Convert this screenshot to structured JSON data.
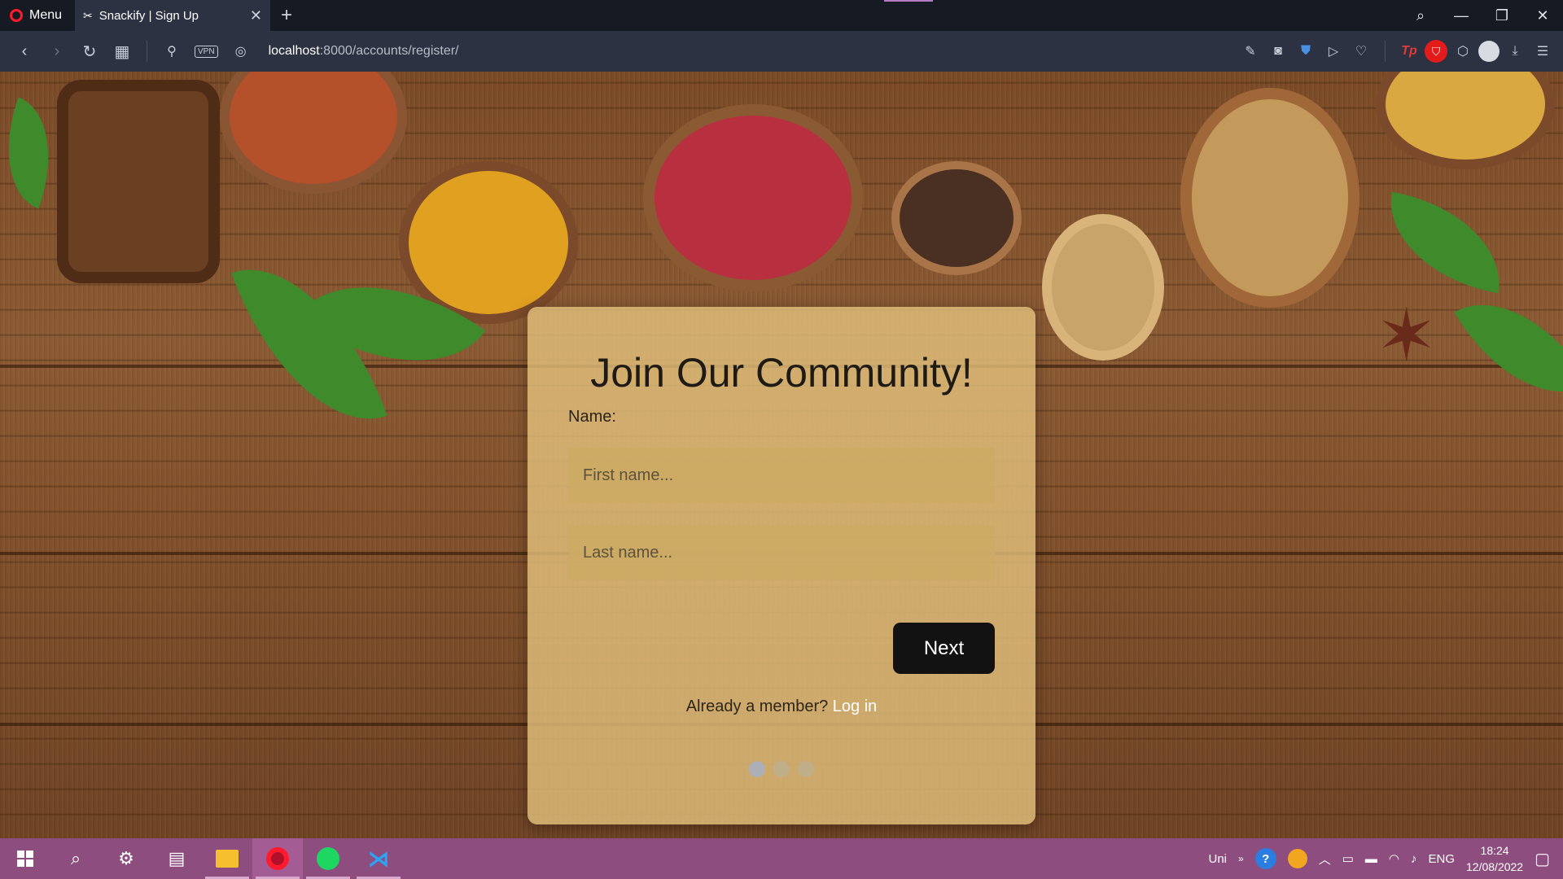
{
  "browser": {
    "menu_label": "Menu",
    "tab_title": "Snackify | Sign Up",
    "tab_close": "✕",
    "new_tab": "+",
    "url_host": "localhost",
    "url_path": ":8000/accounts/register/",
    "vpn_label": "VPN",
    "window_controls": {
      "search": "⌕",
      "minimize": "—",
      "restore": "❐",
      "close": "✕"
    }
  },
  "form": {
    "title": "Join Our Community!",
    "name_label": "Name:",
    "first_name_placeholder": "First name...",
    "last_name_placeholder": "Last name...",
    "next_button": "Next",
    "member_prompt": "Already a member?",
    "login_link": "Log in",
    "steps_total": 3,
    "current_step": 1
  },
  "taskbar": {
    "keyboard_short": "Uni",
    "language": "ENG",
    "time": "18:24",
    "date": "12/08/2022"
  },
  "colors": {
    "card_bg": "#e4c27d",
    "button_bg": "#121212",
    "taskbar_bg": "#8d4e7f",
    "tab_strip_bg": "#161a22",
    "address_bar_bg": "#2c3242"
  }
}
